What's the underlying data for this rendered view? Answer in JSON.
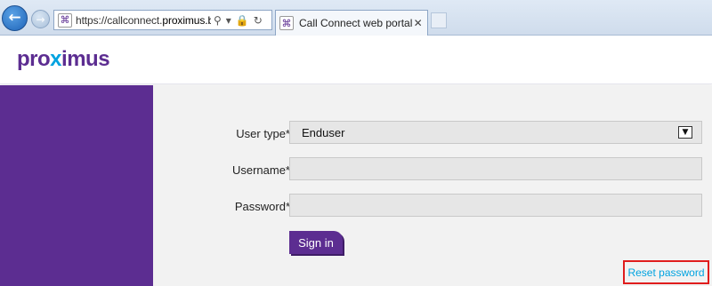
{
  "browser": {
    "url_prefix": "https://callconnect.",
    "url_domain": "proximus.be",
    "url_suffix": "/",
    "tab_title": "Call Connect web portal",
    "icons": [
      "back-icon",
      "forward-icon",
      "favicon",
      "search-icon",
      "dropdown-icon",
      "lock-icon",
      "refresh-icon",
      "close-icon"
    ]
  },
  "header": {
    "logo_part1": "pro",
    "logo_x": "x",
    "logo_part2": "imus"
  },
  "form": {
    "user_type_label": "User type*",
    "user_type_value": "Enduser",
    "username_label": "Username*",
    "username_value": "",
    "password_label": "Password*",
    "password_value": "",
    "signin_label": "Sign in"
  },
  "links": {
    "reset_password": "Reset password"
  },
  "colors": {
    "brand_purple": "#5c2d91",
    "brand_blue": "#00a3e0",
    "highlight_red": "#e01d1d",
    "content_bg": "#f2f2f2"
  }
}
